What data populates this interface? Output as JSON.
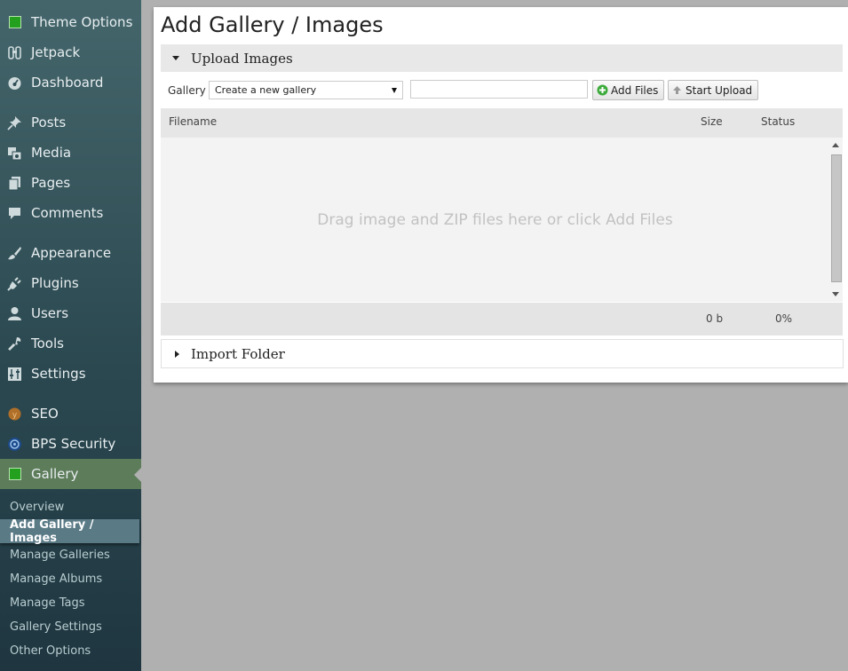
{
  "sidebar": {
    "items": [
      {
        "label": "Theme Options",
        "icon": "green-square-icon"
      },
      {
        "label": "Jetpack",
        "icon": "jetpack-icon"
      },
      {
        "label": "Dashboard",
        "icon": "dashboard-icon"
      },
      {
        "label": "Posts",
        "icon": "pushpin-icon"
      },
      {
        "label": "Media",
        "icon": "media-icon"
      },
      {
        "label": "Pages",
        "icon": "pages-icon"
      },
      {
        "label": "Comments",
        "icon": "comment-icon"
      },
      {
        "label": "Appearance",
        "icon": "paintbrush-icon"
      },
      {
        "label": "Plugins",
        "icon": "plug-icon"
      },
      {
        "label": "Users",
        "icon": "user-icon"
      },
      {
        "label": "Tools",
        "icon": "wrench-icon"
      },
      {
        "label": "Settings",
        "icon": "settings-sliders-icon"
      },
      {
        "label": "SEO",
        "icon": "seo-icon"
      },
      {
        "label": "BPS Security",
        "icon": "security-shield-icon"
      },
      {
        "label": "Gallery",
        "icon": "green-square-icon"
      }
    ],
    "submenu": [
      "Overview",
      "Add Gallery / Images",
      "Manage Galleries",
      "Manage Albums",
      "Manage Tags",
      "Gallery Settings",
      "Other Options"
    ],
    "active_color": "#5d7c5a"
  },
  "main": {
    "title": "Add Gallery / Images",
    "upload_section": "Upload Images",
    "gallery_label": "Gallery",
    "gallery_select_value": "Create a new gallery",
    "gallery_name_value": "",
    "add_files_label": "Add Files",
    "start_upload_label": "Start Upload",
    "table": {
      "col_filename": "Filename",
      "col_size": "Size",
      "col_status": "Status",
      "dropzone_text": "Drag image and ZIP files here or click Add Files",
      "total_size": "0 b",
      "total_percent": "0%"
    },
    "import_section": "Import Folder"
  }
}
